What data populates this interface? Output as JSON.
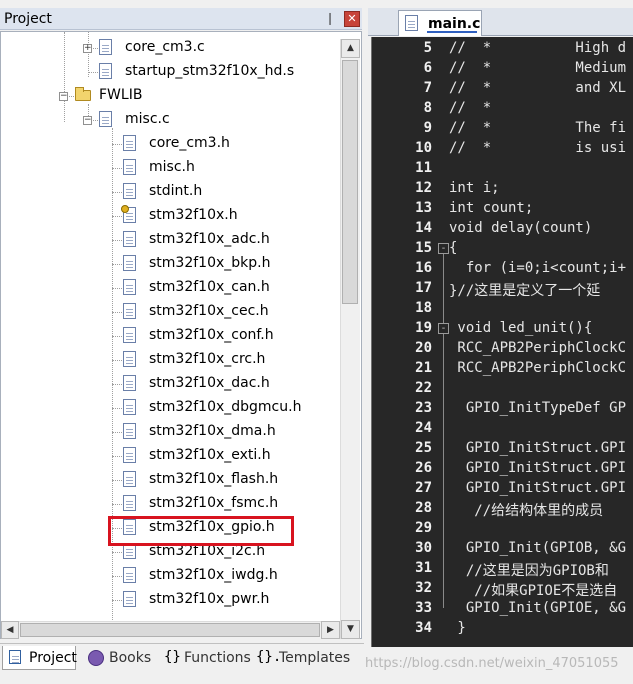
{
  "project_panel": {
    "title": "Project",
    "pin_glyph": "❘",
    "close_glyph": "✕"
  },
  "tree": [
    {
      "label": "core_cm3.c",
      "kind": "file",
      "toggle": "+"
    },
    {
      "label": "startup_stm32f10x_hd.s",
      "kind": "file",
      "toggle": ""
    },
    {
      "label": "FWLIB",
      "kind": "folder",
      "toggle": "-"
    },
    {
      "label": "misc.c",
      "kind": "file",
      "toggle": "-"
    },
    {
      "label": "core_cm3.h",
      "kind": "file"
    },
    {
      "label": "misc.h",
      "kind": "file"
    },
    {
      "label": "stdint.h",
      "kind": "file"
    },
    {
      "label": "stm32f10x.h",
      "kind": "file-key"
    },
    {
      "label": "stm32f10x_adc.h",
      "kind": "file"
    },
    {
      "label": "stm32f10x_bkp.h",
      "kind": "file"
    },
    {
      "label": "stm32f10x_can.h",
      "kind": "file"
    },
    {
      "label": "stm32f10x_cec.h",
      "kind": "file"
    },
    {
      "label": "stm32f10x_conf.h",
      "kind": "file"
    },
    {
      "label": "stm32f10x_crc.h",
      "kind": "file"
    },
    {
      "label": "stm32f10x_dac.h",
      "kind": "file"
    },
    {
      "label": "stm32f10x_dbgmcu.h",
      "kind": "file"
    },
    {
      "label": "stm32f10x_dma.h",
      "kind": "file"
    },
    {
      "label": "stm32f10x_exti.h",
      "kind": "file"
    },
    {
      "label": "stm32f10x_flash.h",
      "kind": "file"
    },
    {
      "label": "stm32f10x_fsmc.h",
      "kind": "file"
    },
    {
      "label": "stm32f10x_gpio.h",
      "kind": "file"
    },
    {
      "label": "stm32f10x_i2c.h",
      "kind": "file"
    },
    {
      "label": "stm32f10x_iwdg.h",
      "kind": "file"
    },
    {
      "label": "stm32f10x_pwr.h",
      "kind": "file"
    }
  ],
  "bottom_tabs": {
    "project": "Project",
    "books": "Books",
    "functions": "Functions",
    "templates": "Templates"
  },
  "editor": {
    "tab_label": "main.c"
  },
  "code_lines": [
    {
      "ln": "5",
      "text": "//  *          High d",
      "fold": ""
    },
    {
      "ln": "6",
      "text": "//  *          Medium",
      "fold": ""
    },
    {
      "ln": "7",
      "text": "//  *          and XL",
      "fold": ""
    },
    {
      "ln": "8",
      "text": "//  *",
      "fold": ""
    },
    {
      "ln": "9",
      "text": "//  *          The fi",
      "fold": ""
    },
    {
      "ln": "10",
      "text": "//  *          is usi",
      "fold": ""
    },
    {
      "ln": "11",
      "text": "",
      "fold": ""
    },
    {
      "ln": "12",
      "text": "int i;",
      "fold": ""
    },
    {
      "ln": "13",
      "text": "int count;",
      "fold": ""
    },
    {
      "ln": "14",
      "text": "void delay(count)",
      "fold": ""
    },
    {
      "ln": "15",
      "text": "{",
      "fold": "-"
    },
    {
      "ln": "16",
      "text": "  for (i=0;i<count;i+",
      "fold": ""
    },
    {
      "ln": "17",
      "text": "}//这里是定义了一个延",
      "fold": ""
    },
    {
      "ln": "18",
      "text": "",
      "fold": ""
    },
    {
      "ln": "19",
      "text": " void led_unit(){",
      "fold": "-"
    },
    {
      "ln": "20",
      "text": " RCC_APB2PeriphClockC",
      "fold": ""
    },
    {
      "ln": "21",
      "text": " RCC_APB2PeriphClockC",
      "fold": ""
    },
    {
      "ln": "22",
      "text": "",
      "fold": ""
    },
    {
      "ln": "23",
      "text": "  GPIO_InitTypeDef GP",
      "fold": ""
    },
    {
      "ln": "24",
      "text": "",
      "fold": ""
    },
    {
      "ln": "25",
      "text": "  GPIO_InitStruct.GPI",
      "fold": ""
    },
    {
      "ln": "26",
      "text": "  GPIO_InitStruct.GPI",
      "fold": ""
    },
    {
      "ln": "27",
      "text": "  GPIO_InitStruct.GPI",
      "fold": ""
    },
    {
      "ln": "28",
      "text": "   //给结构体里的成员",
      "fold": ""
    },
    {
      "ln": "29",
      "text": "",
      "fold": ""
    },
    {
      "ln": "30",
      "text": "  GPIO_Init(GPIOB, &G",
      "fold": ""
    },
    {
      "ln": "31",
      "text": "  //这里是因为GPIOB和",
      "fold": ""
    },
    {
      "ln": "32",
      "text": "   //如果GPIOE不是选自",
      "fold": ""
    },
    {
      "ln": "33",
      "text": "  GPIO_Init(GPIOE, &G",
      "fold": ""
    },
    {
      "ln": "34",
      "text": " }",
      "fold": ""
    }
  ],
  "watermark": "https://blog.csdn.net/weixin_47051055"
}
